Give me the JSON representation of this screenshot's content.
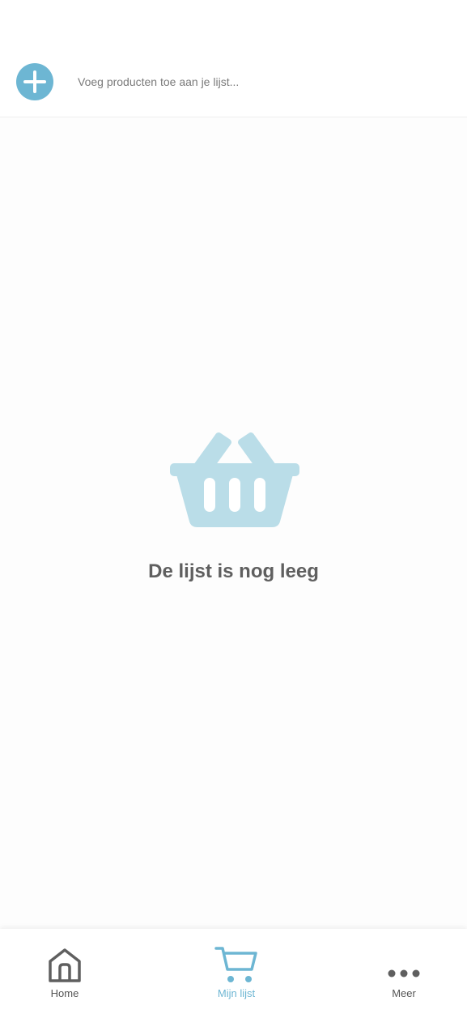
{
  "colors": {
    "accent": "#6db6d3",
    "basket": "#badde8",
    "text_muted": "#5f5f5f"
  },
  "add_bar": {
    "button_icon": "plus-icon",
    "placeholder": "Voeg producten toe aan je lijst..."
  },
  "empty_state": {
    "icon": "shopping-basket-icon",
    "message": "De lijst is nog leeg"
  },
  "bottom_nav": {
    "items": [
      {
        "label": "Home",
        "icon": "home-icon",
        "active": false
      },
      {
        "label": "Mijn lijst",
        "icon": "cart-icon",
        "active": true
      },
      {
        "label": "Meer",
        "icon": "more-dots-icon",
        "active": false
      }
    ]
  }
}
